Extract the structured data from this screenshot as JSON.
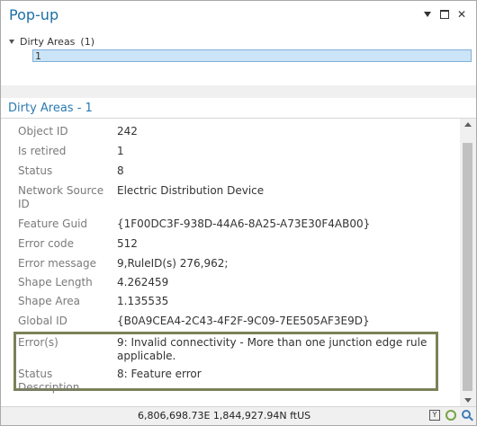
{
  "window": {
    "title": "Pop-up"
  },
  "tree": {
    "layer_name": "Dirty Areas",
    "count": "(1)",
    "selected_item": "1"
  },
  "section": {
    "title": "Dirty Areas - 1"
  },
  "fields": [
    {
      "label": "Object ID",
      "value": "242"
    },
    {
      "label": "Is retired",
      "value": "1"
    },
    {
      "label": "Status",
      "value": "8"
    },
    {
      "label": "Network Source ID",
      "value": "Electric Distribution Device"
    },
    {
      "label": "Feature Guid",
      "value": "{1F00DC3F-938D-44A6-8A25-A73E30F4AB00}"
    },
    {
      "label": "Error code",
      "value": "512"
    },
    {
      "label": "Error message",
      "value": "9,RuleID(s) 276,962;"
    },
    {
      "label": "Shape Length",
      "value": "4.262459"
    },
    {
      "label": "Shape Area",
      "value": "1.135535"
    },
    {
      "label": "Global ID",
      "value": "{B0A9CEA4-2C43-4F2F-9C09-7EE505AF3E9D}"
    },
    {
      "label": "Error(s)",
      "value": "9: Invalid connectivity - More than one junction edge rule applicable."
    },
    {
      "label": "Status Description",
      "value": "8: Feature error"
    }
  ],
  "status": {
    "coordinates": "6,806,698.73E 1,844,927.94N ftUS"
  },
  "colors": {
    "title": "#1d6fa5",
    "section": "#2a7ab3",
    "highlight_border": "#7b8157",
    "selection": "#cce4f7"
  }
}
